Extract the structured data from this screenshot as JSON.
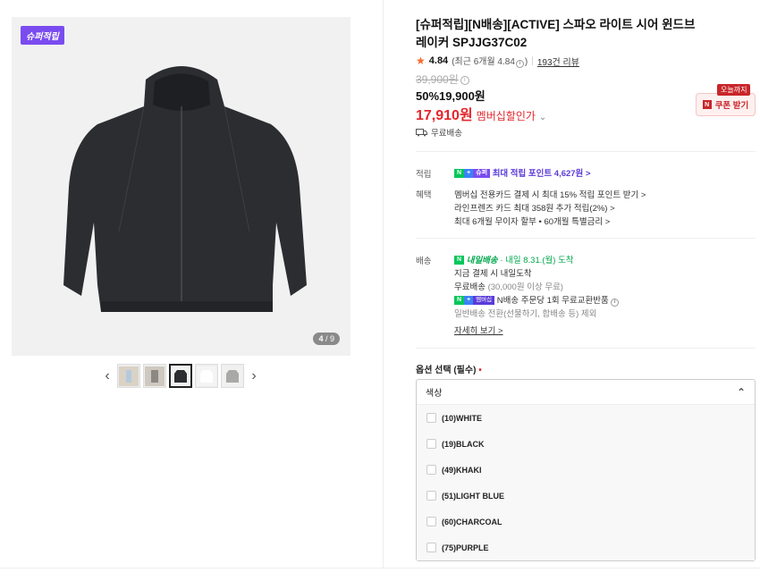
{
  "gallery": {
    "badge": "슈퍼적립",
    "counter_current": "4",
    "counter_total": "/ 9",
    "thumb_prev_icon": "chevron-left-icon",
    "thumb_next_icon": "chevron-right-icon"
  },
  "product": {
    "title": "[슈퍼적립][N배송][ACTIVE] 스파오 라이트 시어 윈드브레이커 SPJJG37C02",
    "rating": "4.84",
    "rating_recent": "(최근 6개월 4.84",
    "rating_recent_close": ")",
    "reviews": "193건 리뷰",
    "original_price": "39,900원",
    "discount": "50%",
    "sale_price": "19,900원",
    "member_price": "17,910원",
    "member_label": "멤버십할인가",
    "shipping_free": "무료배송"
  },
  "coupon": {
    "today": "오늘까지",
    "label": "쿠폰 받기",
    "n_mark": "N"
  },
  "benefits": {
    "points_label": "적립",
    "points_tag_n": "N",
    "points_tag_plus": "+",
    "points_tag_super": "슈퍼",
    "points_text": "최대 적립 포인트 4,627원 >",
    "benefit_label": "혜택",
    "benefit_lines": [
      "멤버십 전용카드 결제 시 최대 15% 적립 포인트 받기 >",
      "라인프렌즈 카드 최대 358원 추가 적립(2%) >",
      "최대 6개월 무이자 할부 • 60개월 특별금리 >"
    ]
  },
  "delivery": {
    "label": "배송",
    "tag_n": "N",
    "tomorrow": "내일배송",
    "arrival": "· 내일 8.31.(월) 도착",
    "line1": "지금 결제 시 내일도착",
    "line2_a": "무료배송",
    "line2_b": "(30,000원 이상 무료)",
    "line3_tag_n": "N",
    "line3_tag_plus": "+",
    "line3_tag_member": "멤버십",
    "line3": "N배송 주문당 1회 무료교환반품",
    "line4": "일반배송 전환(선물하기, 합배송 등) 제외",
    "more": "자세히 보기 >"
  },
  "options": {
    "label": "옵션 선택 (필수)",
    "required_mark": "•",
    "dropdown_title": "색상",
    "items": [
      "(10)WHITE",
      "(19)BLACK",
      "(49)KHAKI",
      "(51)LIGHT BLUE",
      "(60)CHARCOAL",
      "(75)PURPLE"
    ]
  }
}
